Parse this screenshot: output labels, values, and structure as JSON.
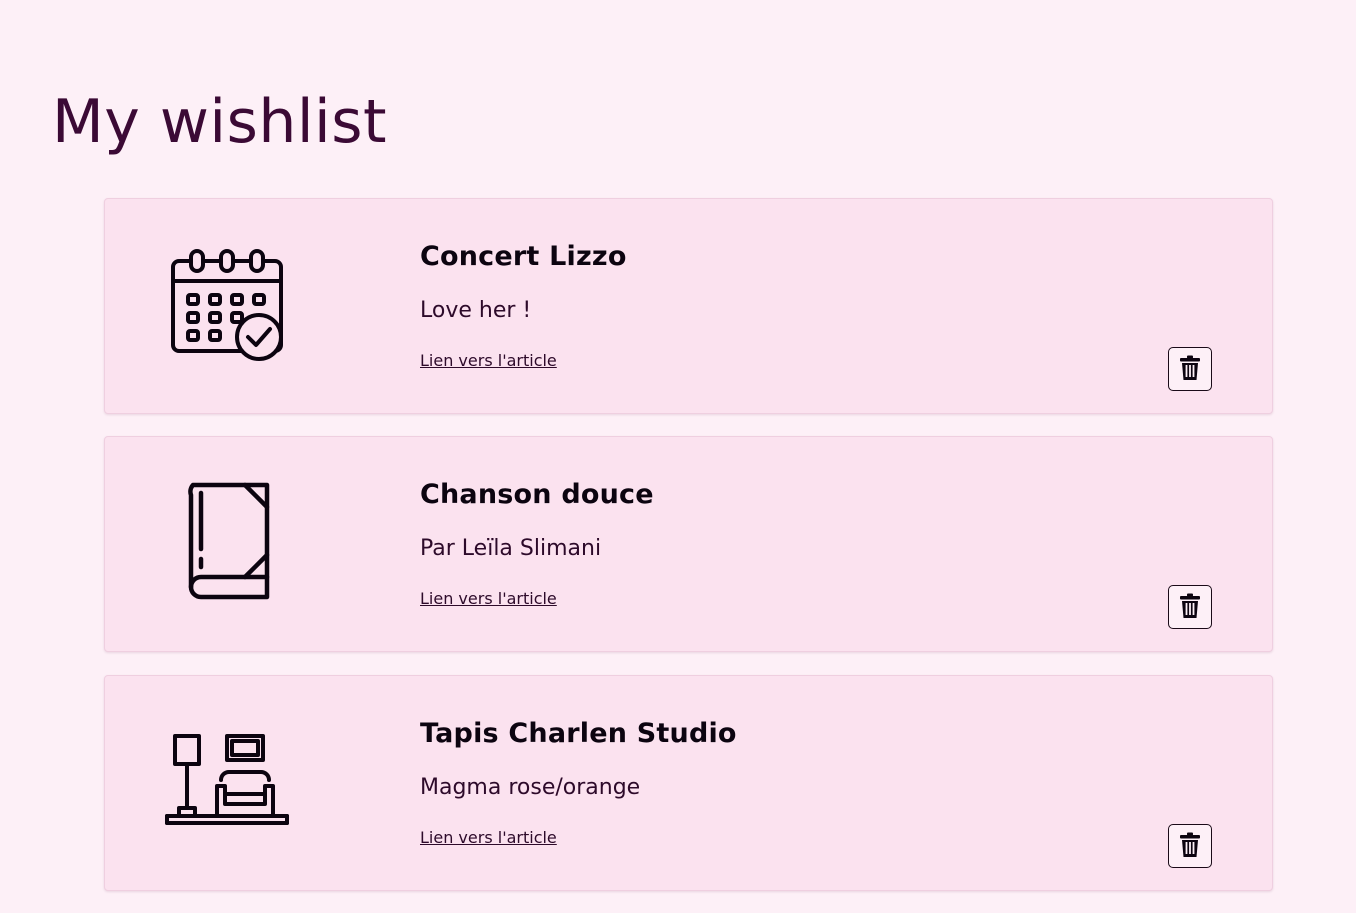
{
  "page": {
    "title": "My wishlist"
  },
  "wishlist": {
    "items": [
      {
        "title": "Concert Lizzo",
        "description": "Love her !",
        "link_label": "Lien vers l'article",
        "icon": "calendar-check-icon",
        "delete_icon": "trash-icon"
      },
      {
        "title": "Chanson douce",
        "description": "Par Leïla Slimani",
        "link_label": "Lien vers l'article",
        "icon": "book-icon",
        "delete_icon": "trash-icon"
      },
      {
        "title": "Tapis Charlen Studio",
        "description": "Magma rose/orange",
        "link_label": "Lien vers l'article",
        "icon": "living-room-icon",
        "delete_icon": "trash-icon"
      }
    ]
  },
  "colors": {
    "page_background": "#fdf0f7",
    "card_background": "#fbe2ef",
    "title_text": "#3b0a35",
    "item_title_text": "#0c0410"
  }
}
